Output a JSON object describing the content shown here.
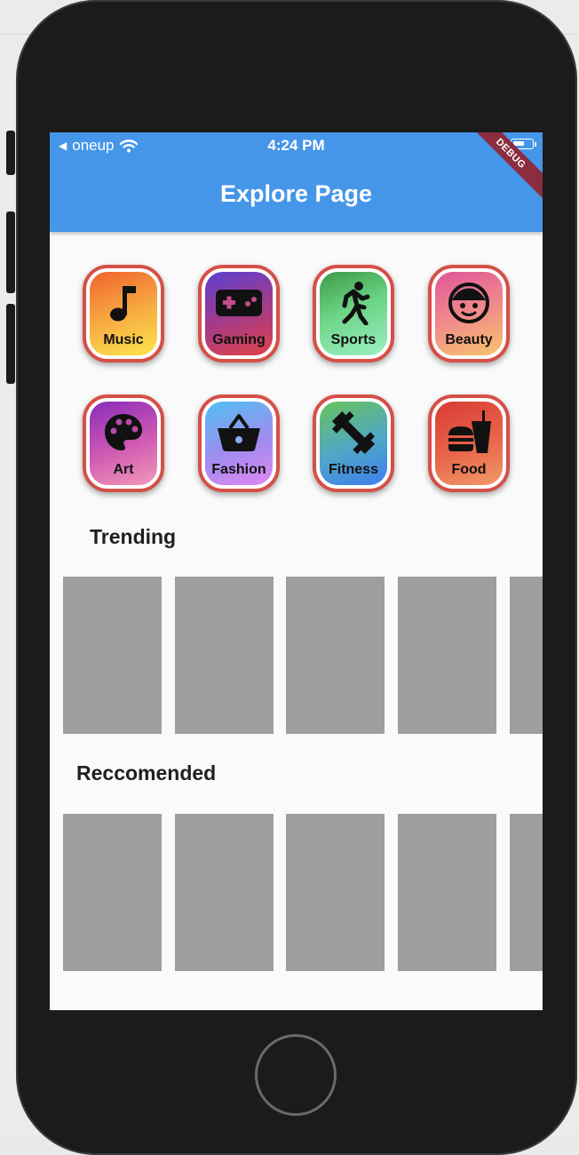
{
  "status_bar": {
    "carrier": "oneup",
    "time": "4:24 PM"
  },
  "app_bar": {
    "title": "Explore Page",
    "debug_banner": "DEBUG"
  },
  "categories": [
    {
      "label": "Music",
      "icon": "music-note-icon"
    },
    {
      "label": "Gaming",
      "icon": "gamepad-icon"
    },
    {
      "label": "Sports",
      "icon": "running-icon"
    },
    {
      "label": "Beauty",
      "icon": "face-icon"
    },
    {
      "label": "Art",
      "icon": "palette-icon"
    },
    {
      "label": "Fashion",
      "icon": "basket-icon"
    },
    {
      "label": "Fitness",
      "icon": "dumbbell-icon"
    },
    {
      "label": "Food",
      "icon": "fastfood-icon"
    }
  ],
  "sections": {
    "trending": "Trending",
    "recommended": "Reccomended"
  },
  "colors": {
    "app_bar": "#4596e9",
    "card_border": "#d55046",
    "placeholder": "#9e9e9e"
  }
}
